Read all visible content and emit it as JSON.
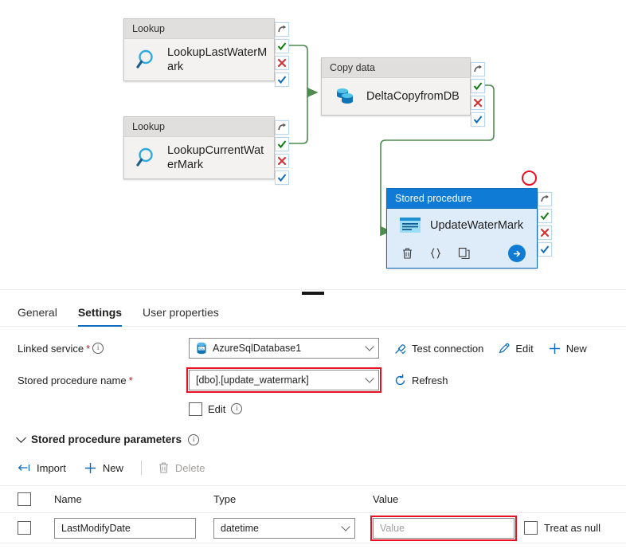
{
  "canvas": {
    "nodes": [
      {
        "type_label": "Lookup",
        "name": "LookupLastWaterMark",
        "icon": "magnifier-icon"
      },
      {
        "type_label": "Lookup",
        "name": "LookupCurrentWaterMark",
        "icon": "magnifier-icon"
      },
      {
        "type_label": "Copy data",
        "name": "DeltaCopyfromDB",
        "icon": "database-copy-icon"
      },
      {
        "type_label": "Stored procedure",
        "name": "UpdateWaterMark",
        "icon": "stored-procedure-icon",
        "selected": true,
        "actions": [
          {
            "name": "delete-activity-icon",
            "glyph": "trash"
          },
          {
            "name": "code-braces-icon",
            "glyph": "{ }"
          },
          {
            "name": "clone-activity-icon",
            "glyph": "copy"
          },
          {
            "name": "run-activity-icon",
            "glyph": "arrow-right"
          }
        ]
      }
    ],
    "pins": [
      {
        "name": "skip-pin",
        "glyph": "curved-arrow"
      },
      {
        "name": "success-pin",
        "glyph": "check-green"
      },
      {
        "name": "failure-pin",
        "glyph": "cross-red"
      },
      {
        "name": "completion-pin",
        "glyph": "check-blue"
      }
    ],
    "edge_color": "#4f8a4f",
    "annotation_color": "#e81123"
  },
  "panel": {
    "tabs": [
      {
        "label": "General",
        "active": false
      },
      {
        "label": "Settings",
        "active": true
      },
      {
        "label": "User properties",
        "active": false
      }
    ],
    "linked_service": {
      "label": "Linked service",
      "required": "*",
      "value": "AzureSqlDatabase1",
      "icon": "sql-database-icon",
      "actions": [
        {
          "label": "Test connection",
          "icon": "plug-icon",
          "disabled": false
        },
        {
          "label": "Edit",
          "icon": "pencil-icon",
          "disabled": false
        },
        {
          "label": "New",
          "icon": "plus-icon",
          "disabled": false
        }
      ]
    },
    "stored_procedure_name": {
      "label": "Stored procedure name",
      "required": "*",
      "value": "[dbo].[update_watermark]",
      "highlighted": true,
      "refresh_label": "Refresh",
      "refresh_icon": "refresh-icon"
    },
    "edit_checkbox": {
      "label": "Edit",
      "checked": false
    },
    "parameters_section": {
      "title": "Stored procedure parameters"
    },
    "param_toolbar": [
      {
        "label": "Import",
        "icon": "import-arrow-icon",
        "disabled": false
      },
      {
        "label": "New",
        "icon": "plus-icon",
        "disabled": false
      },
      {
        "label": "Delete",
        "icon": "trash-icon",
        "disabled": true
      }
    ],
    "param_grid": {
      "columns": [
        "Name",
        "Type",
        "Value"
      ],
      "treat_as_null_label": "Treat as null",
      "rows": [
        {
          "name": "LastModifyDate",
          "type": "datetime",
          "value": "",
          "value_placeholder": "Value",
          "value_highlighted": true,
          "selected": false,
          "treat_as_null": false
        }
      ]
    }
  }
}
